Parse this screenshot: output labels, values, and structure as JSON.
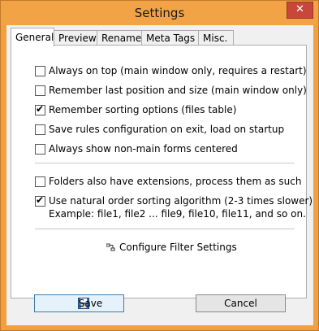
{
  "window": {
    "title": "Settings",
    "close_glyph": "✕"
  },
  "tabs": [
    {
      "label": "General",
      "active": true
    },
    {
      "label": "Preview",
      "active": false
    },
    {
      "label": "Rename",
      "active": false
    },
    {
      "label": "Meta Tags",
      "active": false
    },
    {
      "label": "Misc.",
      "active": false
    }
  ],
  "general": {
    "options": [
      {
        "label": "Always on top (main window only, requires a restart)",
        "checked": false
      },
      {
        "label": "Remember last position and size (main window only)",
        "checked": false
      },
      {
        "label": "Remember sorting options (files table)",
        "checked": true
      },
      {
        "label": "Save rules configuration on exit, load on startup",
        "checked": false
      },
      {
        "label": "Always show non-main forms centered",
        "checked": false
      },
      {
        "label": "Folders also have extensions, process them as such",
        "checked": false
      },
      {
        "label": "Use natural order sorting algorithm (2-3 times slower)",
        "checked": true
      }
    ],
    "example_text": "Example: file1, file2 ... file9, file10, file11, and so on.",
    "filter_link": "Configure Filter Settings",
    "filter_icon": "filter-settings-icon"
  },
  "buttons": {
    "save": "Save",
    "save_icon": "floppy-disk-icon",
    "cancel": "Cancel"
  },
  "colors": {
    "titlebar": "#f2a346",
    "close_button": "#c7483a",
    "check_mark": "#000000"
  }
}
